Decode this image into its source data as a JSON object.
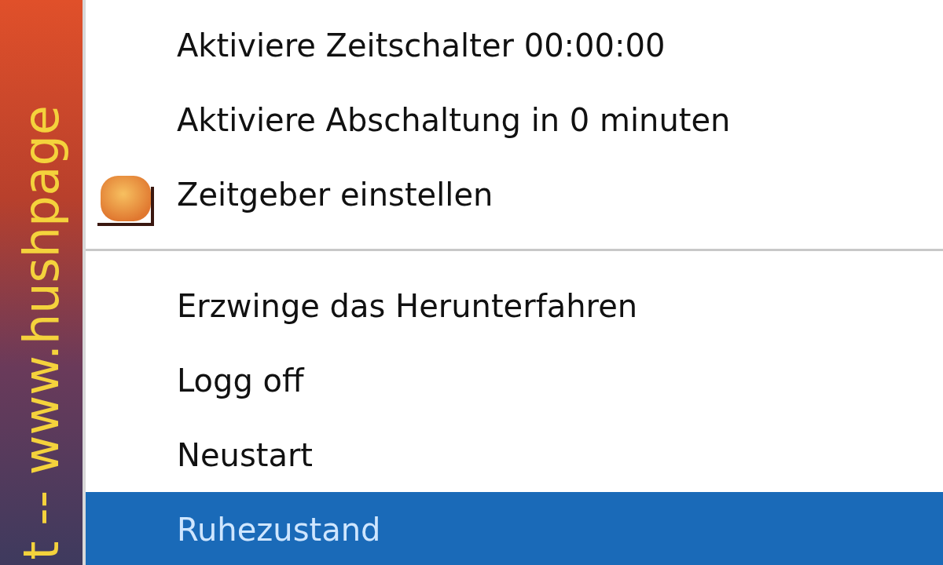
{
  "sidebar": {
    "text": "t -- www.hushpage"
  },
  "menu": {
    "sections": [
      {
        "items": [
          {
            "label": "Aktiviere Zeitschalter 00:00:00",
            "icon": false,
            "selected": false
          },
          {
            "label": "Aktiviere Abschaltung in 0 minuten",
            "icon": false,
            "selected": false
          },
          {
            "label": "Zeitgeber einstellen",
            "icon": true,
            "selected": false
          }
        ]
      },
      {
        "items": [
          {
            "label": "Erzwinge das Herunterfahren",
            "icon": false,
            "selected": false
          },
          {
            "label": "Logg off",
            "icon": false,
            "selected": false
          },
          {
            "label": "Neustart",
            "icon": false,
            "selected": false
          },
          {
            "label": "Ruhezustand",
            "icon": false,
            "selected": true
          }
        ]
      }
    ]
  }
}
